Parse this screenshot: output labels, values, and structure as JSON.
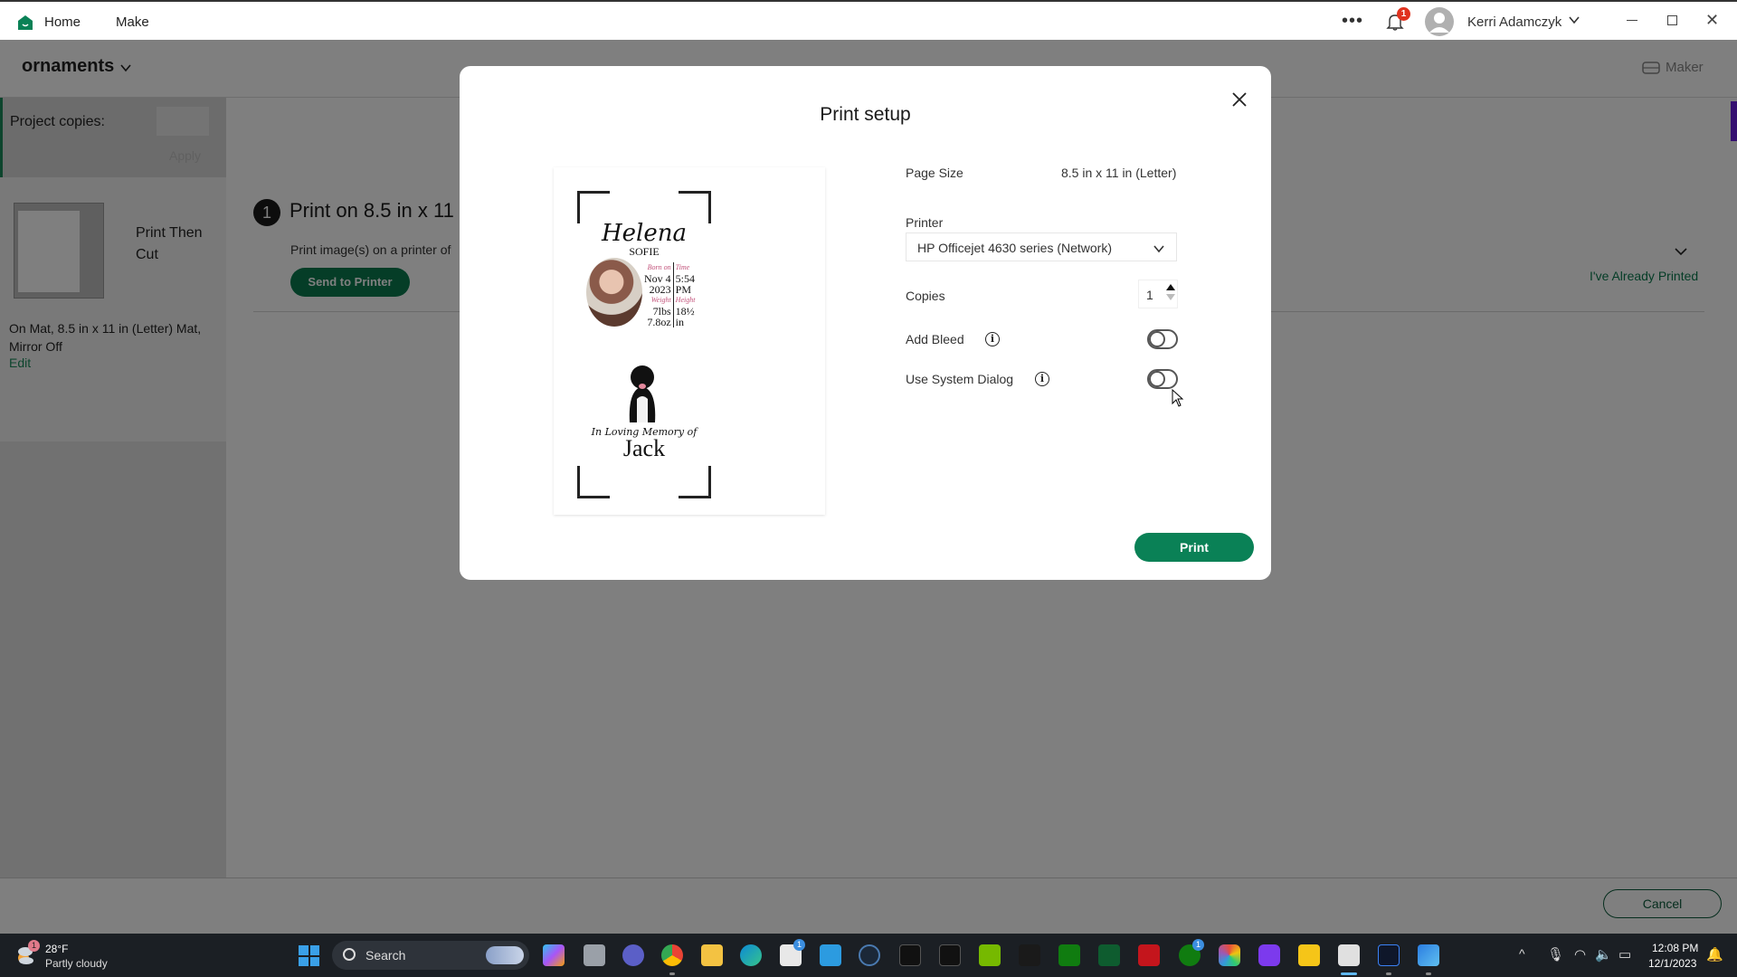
{
  "titlebar": {
    "nav": [
      {
        "label": "Home"
      },
      {
        "label": "Make"
      }
    ],
    "notification_count": "1",
    "user_name": "Kerri Adamczyk",
    "window_controls": [
      "minimize",
      "maximize",
      "close"
    ]
  },
  "project": {
    "name": "ornaments",
    "machine_label": "Maker"
  },
  "sidebar": {
    "copies_label": "Project copies:",
    "apply_label": "Apply",
    "mat_type": "Print Then Cut",
    "mat_description": "On Mat, 8.5 in x 11 in (Letter) Mat, Mirror Off",
    "edit_label": "Edit"
  },
  "step": {
    "number": "1",
    "title": "Print on 8.5 in x 11",
    "description": "Print image(s) on a printer of",
    "send_button": "Send to Printer",
    "already_printed": "I've Already Printed"
  },
  "footer": {
    "cancel_label": "Cancel"
  },
  "modal": {
    "title": "Print setup",
    "page_size_label": "Page Size",
    "page_size_value": "8.5 in x 11 in (Letter)",
    "printer_label": "Printer",
    "printer_value": "HP Officejet 4630 series (Network)",
    "copies_label": "Copies",
    "copies_value": "1",
    "add_bleed_label": "Add Bleed",
    "add_bleed_on": false,
    "system_dialog_label": "Use System Dialog",
    "system_dialog_on": false,
    "print_label": "Print",
    "preview": {
      "name": "Helena",
      "middle_name": "SOFIE",
      "born_label": "Born on",
      "born_date_1": "Nov 4",
      "born_date_2": "2023",
      "time_label": "Time",
      "time_1": "5:54",
      "time_2": "PM",
      "weight_label": "Weight",
      "weight_1": "7lbs",
      "weight_2": "7.8oz",
      "height_label": "Height",
      "height_1": "18½",
      "height_2": "in",
      "memory_text": "In Loving Memory of",
      "pet_name": "Jack"
    }
  },
  "taskbar": {
    "weather_temp": "28°F",
    "weather_desc": "Partly cloudy",
    "weather_badge": "1",
    "search_placeholder": "Search",
    "store_badge": "1",
    "xbox_badge": "1",
    "clock_time": "12:08 PM",
    "clock_date": "12/1/2023"
  },
  "colors": {
    "brand_green": "#0a8156",
    "accent_purple": "#6a1ee0",
    "badge_red": "#e0321e"
  }
}
